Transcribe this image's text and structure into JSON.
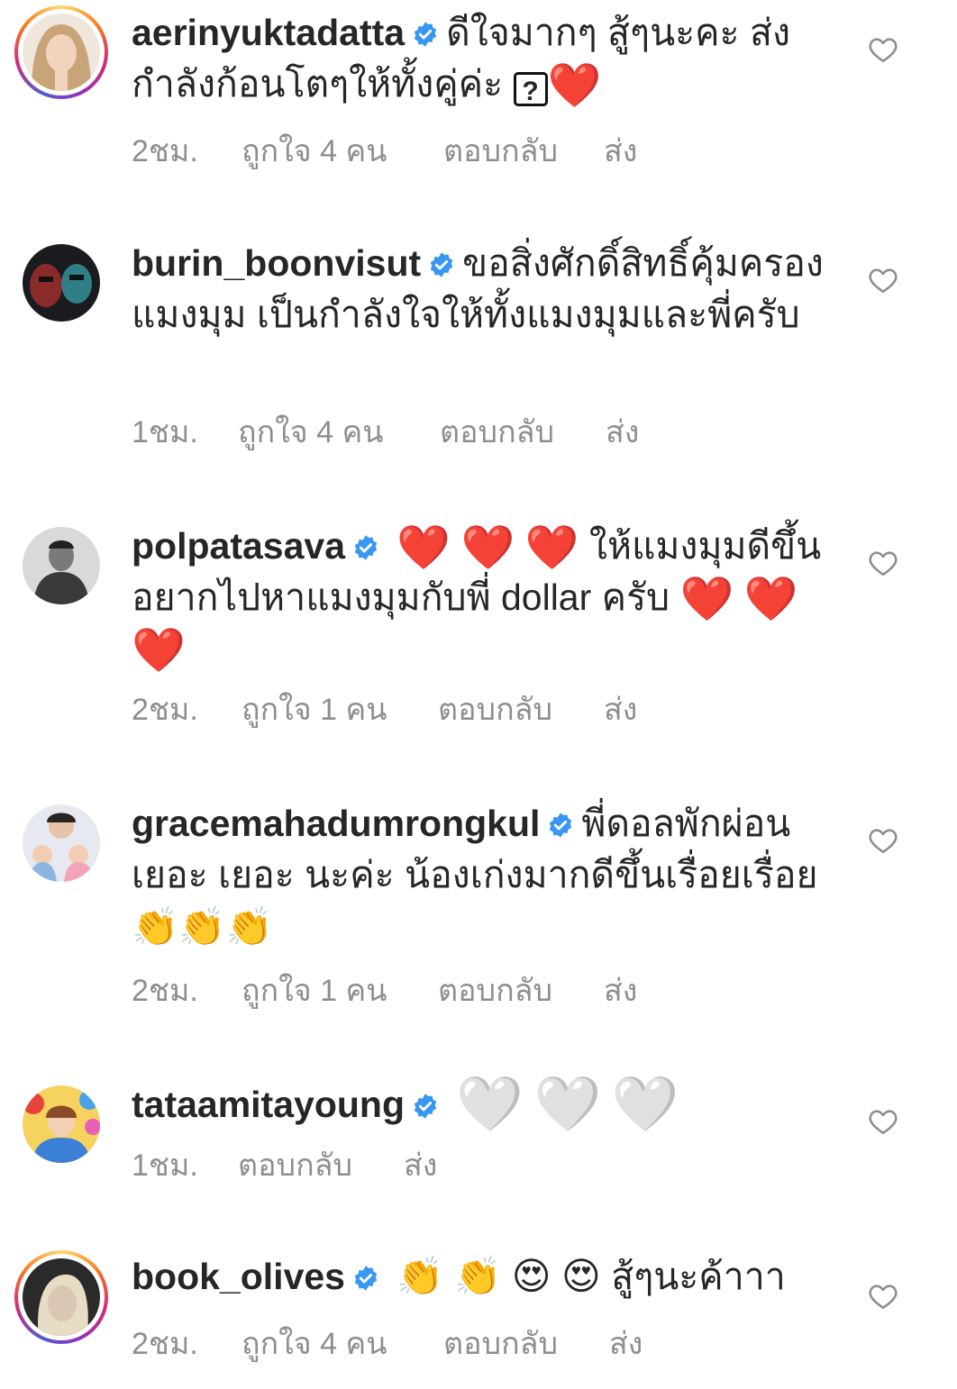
{
  "comments": [
    {
      "username": "aerinyuktadatta",
      "text": "ดีใจมากๆ สู้ๆนะคะ ส่งกำลังก้อนโตๆให้ทั้งคู่ค่ะ",
      "trailing": [
        "?",
        "❤️"
      ],
      "time": "2ชม.",
      "likes": "ถูกใจ 4 คน",
      "reply": "ตอบกลับ",
      "send": "ส่ง"
    },
    {
      "username": "burin_boonvisut",
      "text": "ขอสิ่งศักดิ์สิทธิ์คุ้มครองแมงมุม เป็นกำลังใจให้ทั้งแมงมุมและพี่ครับ",
      "time": "1ชม.",
      "likes": "ถูกใจ 4 คน",
      "reply": "ตอบกลับ",
      "send": "ส่ง"
    },
    {
      "username": "polpatasava",
      "text_pre": [
        "❤️",
        "❤️",
        "❤️"
      ],
      "text": "ให้แมงมุมดีขึ้น อยากไปหาแมงมุมกับพี่ dollar ครับ",
      "trailing": [
        "❤️",
        "❤️",
        "❤️"
      ],
      "time": "2ชม.",
      "likes": "ถูกใจ 1 คน",
      "reply": "ตอบกลับ",
      "send": "ส่ง"
    },
    {
      "username": "gracemahadumrongkul",
      "text": "พี่ดอลพักผ่อน เยอะ เยอะ นะค่ะ น้องเก่งมากดีขึ้นเรื่อยเรื่อย",
      "trailing": [
        "👏",
        "👏",
        "👏"
      ],
      "time": "2ชม.",
      "likes": "ถูกใจ 1 คน",
      "reply": "ตอบกลับ",
      "send": "ส่ง"
    },
    {
      "username": "tataamitayoung",
      "trailing": [
        "🤍",
        "🤍",
        "🤍"
      ],
      "time": "1ชม.",
      "reply": "ตอบกลับ",
      "send": "ส่ง"
    },
    {
      "username": "book_olives",
      "text_pre": [
        "👏",
        "👏",
        "😍",
        "😍"
      ],
      "text": "สู้ๆนะค้าาา",
      "time": "2ชม.",
      "likes": "ถูกใจ 4 คน",
      "reply": "ตอบกลับ",
      "send": "ส่ง"
    }
  ],
  "colors": {
    "verified_badge": "#3897f0",
    "meta_text": "#8e8e8e",
    "heart_emoji": "#e0141e"
  },
  "icons": {
    "verified": "verified-badge-icon",
    "like": "heart-outline-icon"
  }
}
